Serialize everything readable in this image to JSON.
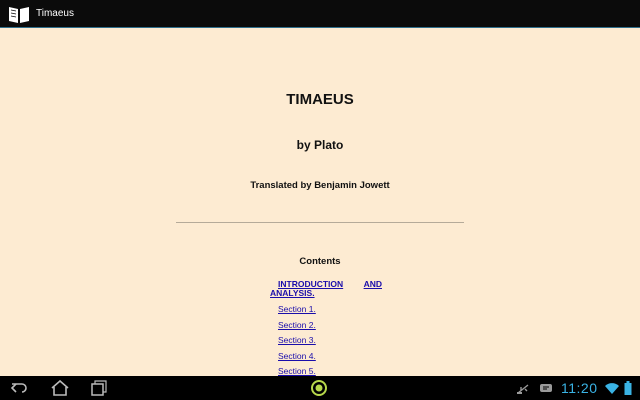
{
  "app": {
    "title": "Timaeus",
    "icon": "book-icon"
  },
  "book": {
    "title": "TIMAEUS",
    "author": "by Plato",
    "translator": "Translated by Benjamin Jowett"
  },
  "contents": {
    "heading": "Contents",
    "intro": {
      "word1": "INTRODUCTION",
      "word2": "AND",
      "word3": "ANALYSIS."
    },
    "sections": [
      "Section 1.",
      "Section 2.",
      "Section 3.",
      "Section 4.",
      "Section 5."
    ]
  },
  "system_bar": {
    "time": "11:20",
    "icons": [
      "back-icon",
      "home-icon",
      "recent-apps-icon",
      "menu-circle-icon",
      "usb-icon",
      "notification-icon",
      "wifi-icon",
      "battery-icon"
    ],
    "accent": "#3ab3e4"
  },
  "colors": {
    "page_bg": "#fdebd2",
    "link": "#1a0dab"
  }
}
